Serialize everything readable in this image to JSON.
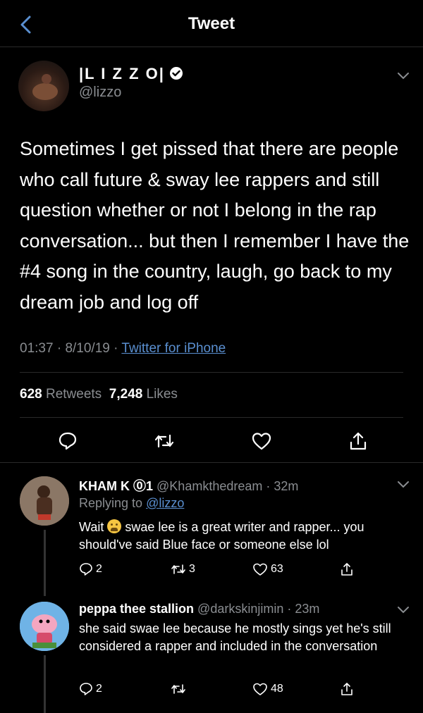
{
  "header": {
    "title": "Tweet"
  },
  "tweet": {
    "name": "|L I Z Z O|",
    "handle": "@lizzo",
    "text": "Sometimes I get pissed that there are people who call future & sway lee rappers and still question whether or not I belong in the rap conversation... but then I remember I have the #4 song in the country, laugh, go back to my dream job and log off",
    "time": "01:37",
    "date": "8/10/19",
    "source": "Twitter for iPhone",
    "retweets_count": "628",
    "retweets_label": "Retweets",
    "likes_count": "7,248",
    "likes_label": "Likes"
  },
  "replies": [
    {
      "name": "KHAM K ⓪1",
      "handle": "@Khamkthedream",
      "time": "32m",
      "replying_label": "Replying to",
      "replying_to": "@lizzo",
      "text_before_emoji": "Wait",
      "text_after_emoji": "swae lee is a great writer and rapper... you should've said Blue face or someone else lol",
      "reply_count": "2",
      "retweet_count": "3",
      "like_count": "63"
    },
    {
      "name": "peppa thee stallion",
      "handle": "@darkskinjimin",
      "time": "23m",
      "text": "she said swae lee because he mostly sings yet he's still considered a rapper and included in the conversation",
      "reply_count": "2",
      "retweet_count": "",
      "like_count": "48"
    }
  ],
  "colors": {
    "background": "#000000",
    "secondary_text": "#8a8d91",
    "link": "#5a8fd0"
  },
  "icons": [
    "back-chevron-icon",
    "verified-icon",
    "chevron-down-icon",
    "reply-icon",
    "retweet-icon",
    "like-icon",
    "share-icon"
  ]
}
